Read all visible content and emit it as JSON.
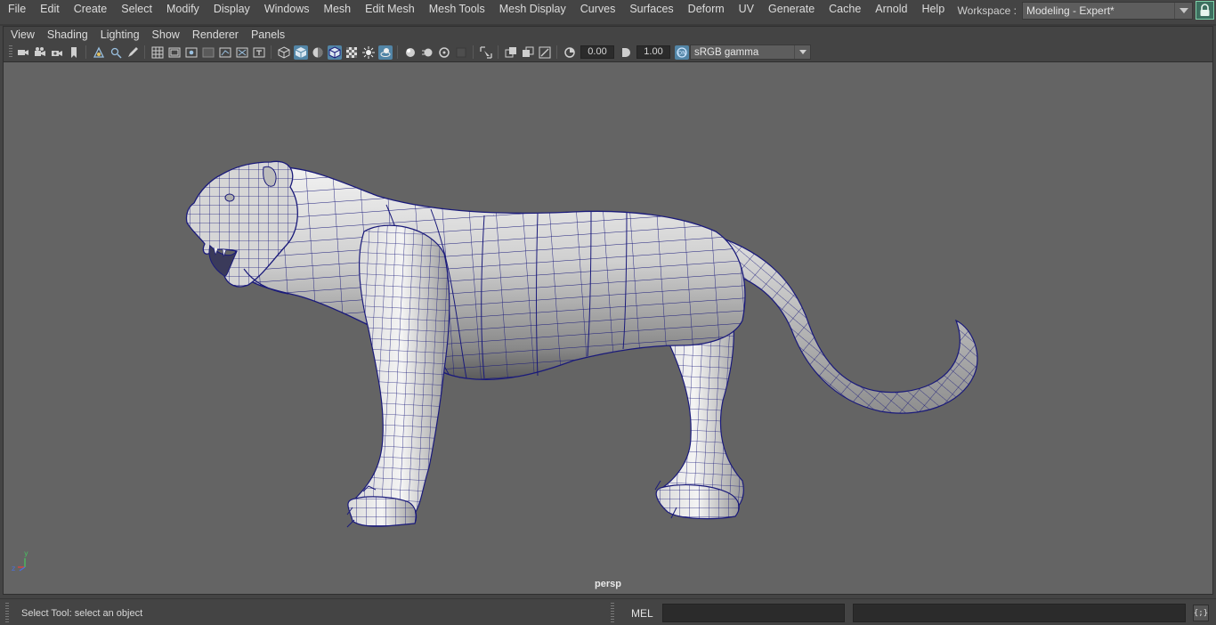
{
  "menubar": {
    "items": [
      "File",
      "Edit",
      "Create",
      "Select",
      "Modify",
      "Display",
      "Windows",
      "Mesh",
      "Edit Mesh",
      "Mesh Tools",
      "Mesh Display",
      "Curves",
      "Surfaces",
      "Deform",
      "UV",
      "Generate",
      "Cache",
      "Arnold",
      "Help"
    ]
  },
  "workspace": {
    "label": "Workspace :",
    "value": "Modeling - Expert*"
  },
  "panel": {
    "menu": [
      "View",
      "Shading",
      "Lighting",
      "Show",
      "Renderer",
      "Panels"
    ],
    "toolbar": {
      "exposure": "0.00",
      "gamma": "1.00",
      "color_space": "sRGB gamma"
    }
  },
  "viewport": {
    "camera": "persp",
    "axis_x": "x",
    "axis_y": "y",
    "axis_z": "z"
  },
  "status": {
    "help_text": "Select Tool: select an object",
    "command_language": "MEL",
    "script_editor_label": "{;}"
  },
  "colors": {
    "wireframe": "#1a1a7a",
    "viewport_bg": "#646464",
    "active_tool": "#5285a6",
    "lock_active": "#3c6f5f"
  }
}
